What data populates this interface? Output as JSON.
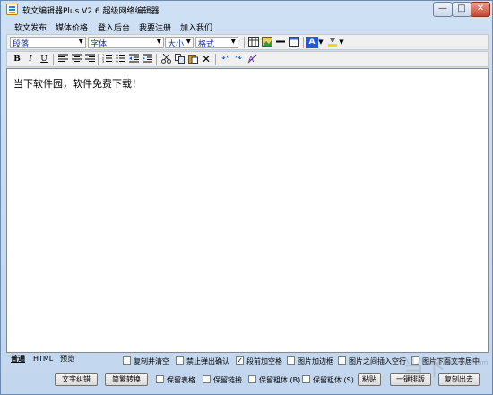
{
  "window": {
    "title": "软文编辑器Plus V2.6 超级网络编辑器",
    "minimize": "—",
    "maximize": "□",
    "close": "✕"
  },
  "menu": [
    "软文发布",
    "媒体价格",
    "登入后台",
    "我要注册",
    "加入我们"
  ],
  "toolbar": {
    "paragraph": "段落",
    "font": "字体",
    "size": "大小",
    "format": "格式",
    "bold": "B",
    "italic": "I",
    "underline": "U"
  },
  "editor": {
    "content": "当下软件园，软件免费下载！"
  },
  "tabs": [
    "普通",
    "HTML",
    "预览"
  ],
  "options_row1": [
    {
      "label": "复制并清空",
      "checked": false
    },
    {
      "label": "禁止弹出确认",
      "checked": false
    },
    {
      "label": "段前加空格",
      "checked": true
    },
    {
      "label": "图片加边框",
      "checked": false
    },
    {
      "label": "图片之间插入空行",
      "checked": false
    },
    {
      "label": "图片下面文字居中",
      "checked": false
    }
  ],
  "options_row2": [
    {
      "label": "保留表格",
      "checked": false
    },
    {
      "label": "保留链接",
      "checked": false
    },
    {
      "label": "保留粗体 (B)",
      "checked": false
    },
    {
      "label": "保留粗体 (S)",
      "checked": false
    }
  ],
  "buttons": {
    "proofread": "文字纠错",
    "convert": "简繁转换",
    "paste": "粘贴",
    "typeset": "一键排版",
    "copy_out": "复制出去"
  },
  "watermark": {
    "text": "当下",
    "sub": "www.downxia.com"
  },
  "colors": {
    "titlebar": "#c2d6ee",
    "editor_bg": "#ffffff",
    "accent": "#1030a0"
  }
}
